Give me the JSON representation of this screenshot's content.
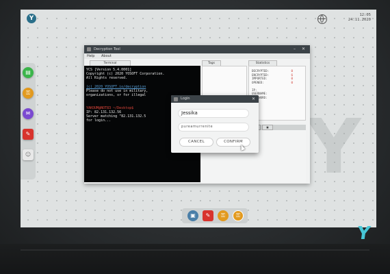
{
  "clock": {
    "time": "12:05",
    "date": "24.11.2020"
  },
  "window": {
    "title": "Decryption Tool",
    "menu": [
      "Help",
      "About"
    ]
  },
  "terminal": {
    "tab": "Terminal",
    "lines": [
      {
        "text": "YCS [Version 5.4.0001]",
        "style": "normal"
      },
      {
        "text": "Copyright (c) 2020 YOSOFT Corporation.",
        "style": "normal"
      },
      {
        "text": "All Rights reserved.",
        "style": "normal"
      },
      {
        "text": "",
        "style": "normal"
      },
      {
        "text": "(c) 2020 YOSOFT.io/decryption",
        "style": "link"
      },
      {
        "text": "Please do not use in military,",
        "style": "normal"
      },
      {
        "text": "organizations, or for illegal",
        "style": "normal"
      },
      {
        "text": "",
        "style": "normal"
      },
      {
        "text": "",
        "style": "normal"
      },
      {
        "text": "YAKOUM@NOT83 ~/Desktop$",
        "style": "red"
      },
      {
        "text": "IP: 82.131.132.56",
        "style": "normal"
      },
      {
        "text": "Server matching \"82.131.132.5",
        "style": "normal"
      },
      {
        "text": "for login...",
        "style": "normal"
      }
    ]
  },
  "tags": {
    "tab": "Tags"
  },
  "stats": {
    "tab": "Statistics",
    "rows": [
      {
        "label": "DECRYPTED:",
        "value": "0"
      },
      {
        "label": "ENCRYPTED:",
        "value": "6"
      },
      {
        "label": "IMPORTED:",
        "value": "0"
      },
      {
        "label": "OPENED:",
        "value": "0"
      },
      {
        "label": "",
        "value": ""
      },
      {
        "label": "IP:",
        "value": ""
      },
      {
        "label": "USERNAME:",
        "value": ""
      },
      {
        "label": "PASSWORD:",
        "value": ""
      }
    ]
  },
  "lower_tabs": {
    "relations": "Relations",
    "star": "★"
  },
  "login": {
    "title": "Login",
    "username": "Jessika",
    "password": "pureamurrenite",
    "cancel": "CANCEL",
    "confirm": "CONFIRM"
  },
  "brand": {
    "letter": "Y",
    "color": "#47c6d6"
  },
  "left_dock": [
    {
      "icon": "chat-icon",
      "color": "#3bb54a",
      "glyph": "▤"
    },
    {
      "icon": "lock-icon",
      "color": "#e29a1f",
      "glyph": "🔒"
    },
    {
      "icon": "mail-icon",
      "color": "#7b4ad1",
      "glyph": "✉"
    },
    {
      "icon": "tool-icon",
      "color": "#d8332d",
      "glyph": "✎"
    },
    {
      "icon": "contact-icon",
      "color": "#e8e8e8",
      "glyph": "👤"
    }
  ],
  "bottom_dock": [
    {
      "icon": "monitor-icon",
      "color": "#4a7fa8",
      "glyph": "▣"
    },
    {
      "icon": "tool-icon",
      "color": "#d8332d",
      "glyph": "✎"
    },
    {
      "icon": "lock-icon",
      "color": "#e29a1f",
      "glyph": "🔒"
    },
    {
      "icon": "lock-icon",
      "color": "#e29a1f",
      "glyph": "🔒"
    }
  ]
}
